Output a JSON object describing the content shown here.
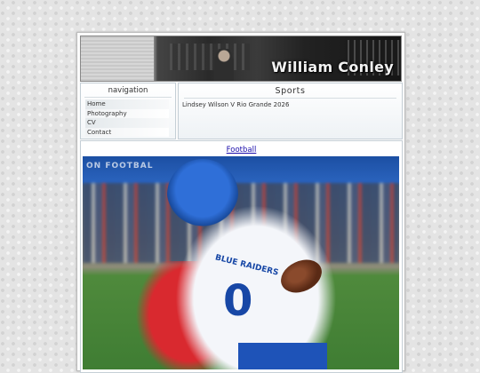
{
  "site": {
    "title": "William Conley"
  },
  "navigation": {
    "heading": "navigation",
    "items": [
      {
        "label": "Home"
      },
      {
        "label": "Photography"
      },
      {
        "label": "CV"
      },
      {
        "label": "Contact"
      }
    ]
  },
  "sports": {
    "heading": "Sports",
    "items": [
      {
        "label": "Lindsey Wilson V Rio Grande 2026"
      }
    ]
  },
  "content": {
    "link_label": "Football",
    "photo": {
      "jersey_text": "BLUE RAIDERS",
      "number": "0",
      "banner_text": "ON FOOTBAL"
    }
  },
  "colors": {
    "link": "#1a0dab",
    "panel_border": "#c5cfd6",
    "jersey_blue": "#1747a6",
    "opponent_red": "#d9292f"
  }
}
